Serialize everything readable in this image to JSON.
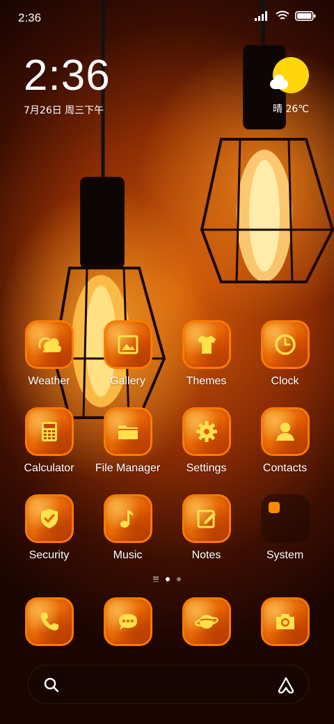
{
  "status_bar": {
    "time": "2:36"
  },
  "clock_widget": {
    "time": "2:36",
    "date": "7月26日 周三下午"
  },
  "weather_widget": {
    "condition": "晴",
    "temperature": "26℃"
  },
  "apps": [
    {
      "label": "Weather",
      "icon": "weather-icon"
    },
    {
      "label": "Gallery",
      "icon": "gallery-icon"
    },
    {
      "label": "Themes",
      "icon": "tshirt-icon"
    },
    {
      "label": "Clock",
      "icon": "clock-icon"
    },
    {
      "label": "Calculator",
      "icon": "calculator-icon"
    },
    {
      "label": "File Manager",
      "icon": "folder-icon"
    },
    {
      "label": "Settings",
      "icon": "gear-icon"
    },
    {
      "label": "Contacts",
      "icon": "person-icon"
    },
    {
      "label": "Security",
      "icon": "shield-check-icon"
    },
    {
      "label": "Music",
      "icon": "music-note-icon"
    },
    {
      "label": "Notes",
      "icon": "pencil-note-icon"
    },
    {
      "label": "System",
      "icon": "folder-grid-icon"
    }
  ],
  "dock": [
    {
      "icon": "phone-icon"
    },
    {
      "icon": "chat-bubble-icon"
    },
    {
      "icon": "planet-icon"
    },
    {
      "icon": "camera-icon"
    }
  ],
  "page_indicator": {
    "pages": 2,
    "current": 1
  },
  "colors": {
    "accent": "#ff8a00",
    "icon_glyph": "#ffe14a",
    "sun": "#ffd60a"
  }
}
